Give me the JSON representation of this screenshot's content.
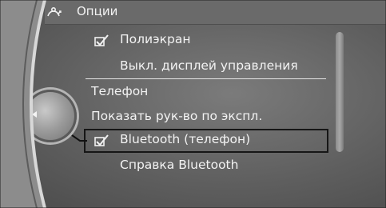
{
  "header": {
    "icon": "options-icon",
    "title": "Опции"
  },
  "menu": [
    {
      "label": "Полиэкран",
      "checked": true
    },
    {
      "label": "Выкл. дисплей управления",
      "checked": false
    },
    {
      "label": "Телефон",
      "checked": false
    },
    {
      "label": "Показать рук-во по экспл.",
      "checked": false
    },
    {
      "label": "Bluetooth (телефон)",
      "checked": true,
      "selected": true
    },
    {
      "label": "Справка Bluetooth",
      "checked": false
    }
  ],
  "controller": {
    "icon": "left-arrow-icon"
  }
}
